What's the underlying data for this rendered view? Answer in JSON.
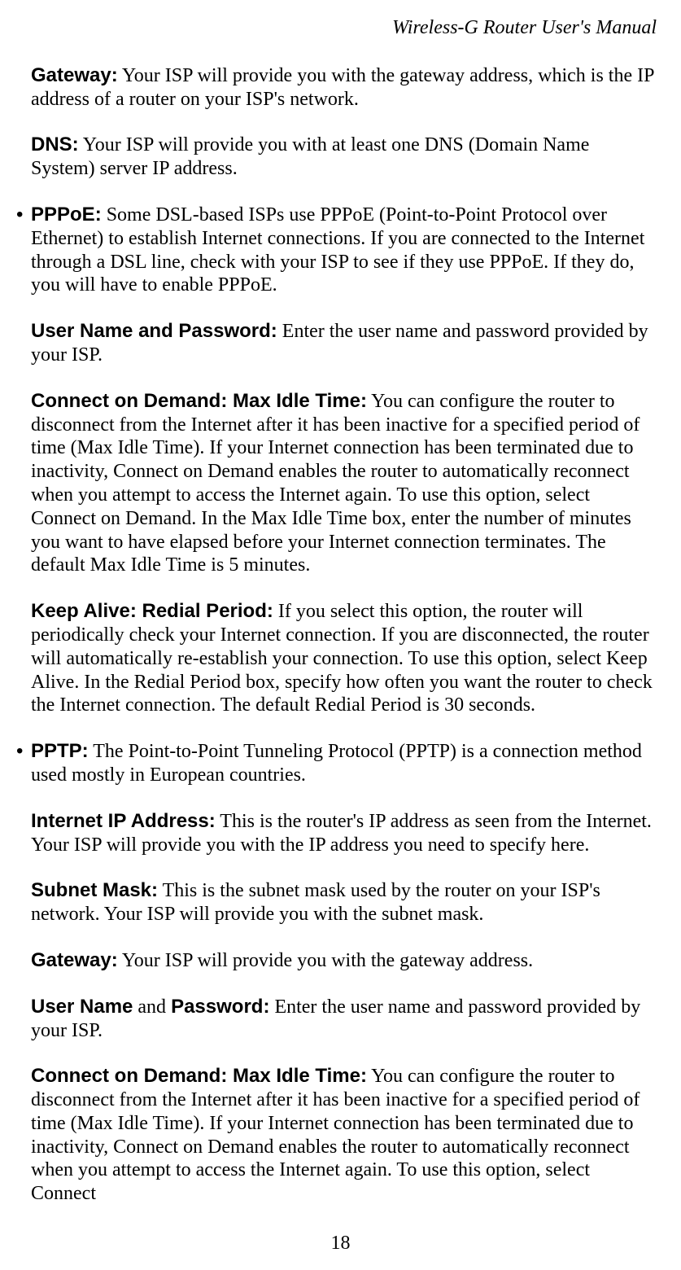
{
  "header": "Wireless-G Router User's Manual",
  "page_number": "18",
  "paragraphs": {
    "p1": {
      "label": "Gateway:",
      "text": " Your ISP will provide you with the gateway address, which is the IP address of a router on your ISP's network."
    },
    "p2": {
      "label": "DNS:",
      "text": " Your ISP will provide you with at least one DNS (Domain Name System) server IP address."
    },
    "p3": {
      "label": "PPPoE:",
      "text": " Some DSL-based ISPs use PPPoE (Point-to-Point Protocol over Ethernet) to establish Internet connections. If you are connected to the Internet through a DSL line, check with your ISP to see if they use PPPoE. If they do, you will have to enable PPPoE."
    },
    "p4": {
      "label": "User Name and Password:",
      "text": " Enter the user name and password provided by your ISP."
    },
    "p5": {
      "label": "Connect on Demand: Max Idle Time:",
      "text": " You can configure the router to disconnect from the Internet after it has been inactive for a specified period of time (Max Idle Time). If your Internet connection has been terminated due to inactivity, Connect on Demand enables the router to automatically reconnect when you attempt to access the Internet again. To use this option, select Connect on Demand. In the Max Idle Time box, enter the number of minutes you want to have elapsed before your Internet connection terminates. The default Max Idle Time is 5 minutes."
    },
    "p6": {
      "label": "Keep Alive: Redial Period:",
      "text": " If you select this option, the router will periodically check your Internet connection. If you are disconnected, the router will automatically re-establish your connection. To use this option, select Keep Alive. In the Redial Period box, specify how often you want the router to check the Internet connection. The default Redial Period is 30 seconds."
    },
    "p7": {
      "label": "PPTP:",
      "text": " The Point-to-Point Tunneling Protocol (PPTP) is a connection method used mostly in European countries."
    },
    "p8": {
      "label": "Internet IP Address:",
      "text": " This is the router's IP address as seen from the Internet. Your ISP will provide you with the IP address you need to specify here."
    },
    "p9": {
      "label": "Subnet Mask:",
      "text": " This is the subnet mask used by the router on your ISP's network. Your ISP will provide you with the subnet mask."
    },
    "p10": {
      "label": "Gateway:",
      "text": " Your ISP will provide you with the gateway address."
    },
    "p11": {
      "label1": "User Name",
      "mid": " and ",
      "label2": "Password:",
      "text": " Enter the user name and password provided by your ISP."
    },
    "p12": {
      "label": "Connect on Demand: Max Idle Time:",
      "text": " You can configure the router to disconnect from the Internet after it has been inactive for a specified period of time (Max Idle Time). If your Internet connection has been terminated due to inactivity, Connect on Demand enables the router to automatically reconnect when you attempt to access the Internet again. To use this option, select Connect"
    }
  }
}
